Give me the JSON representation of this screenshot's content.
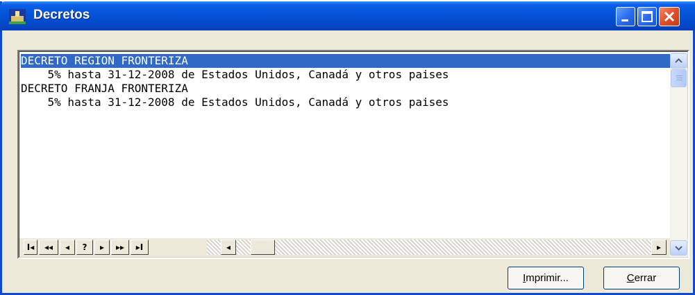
{
  "window": {
    "title": "Decretos",
    "icons": {
      "app": "building-icon",
      "minimize": "minimize-icon",
      "maximize": "maximize-icon",
      "close": "close-icon"
    }
  },
  "list": {
    "lines": [
      {
        "text": "DECRETO REGION FRONTERIZA",
        "selected": true
      },
      {
        "text": "    5% hasta 31-12-2008 de Estados Unidos, Canadá y otros paises",
        "selected": false
      },
      {
        "text": "DECRETO FRANJA FRONTERIZA",
        "selected": false
      },
      {
        "text": "    5% hasta 31-12-2008 de Estados Unidos, Canadá y otros paises",
        "selected": false
      }
    ]
  },
  "navigation": {
    "buttons": [
      {
        "name": "first-record-button",
        "glyph": "I◂"
      },
      {
        "name": "previous-page-button",
        "glyph": "◂◂"
      },
      {
        "name": "previous-record-button",
        "glyph": "◂"
      },
      {
        "name": "find-button",
        "glyph": "?"
      },
      {
        "name": "next-record-button",
        "glyph": "▸"
      },
      {
        "name": "next-page-button",
        "glyph": "▸▸"
      },
      {
        "name": "last-record-button",
        "glyph": "▸I"
      }
    ]
  },
  "buttons": {
    "print": {
      "mnemonic": "I",
      "rest": "mprimir..."
    },
    "close": {
      "mnemonic": "C",
      "rest": "errar"
    }
  },
  "colors": {
    "titlebar": "#0453d8",
    "selection": "#316ac5",
    "face": "#ece9d8"
  }
}
